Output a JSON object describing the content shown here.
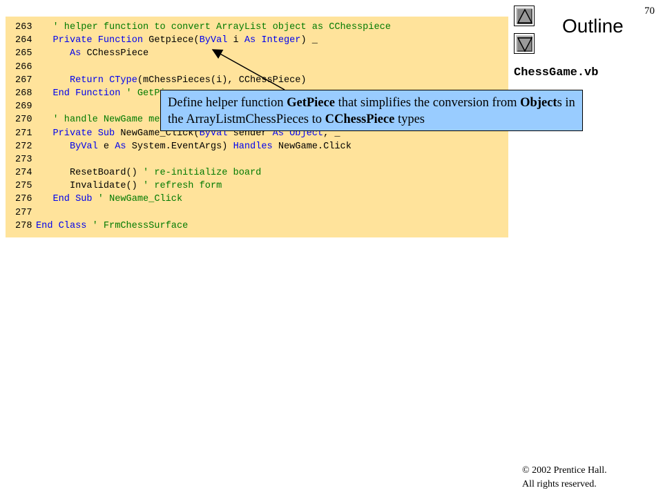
{
  "page_number": "70",
  "outline": {
    "title": "Outline",
    "file_name": "ChessGame.vb",
    "up_icon": "triangle-up-icon",
    "down_icon": "triangle-down-icon"
  },
  "code": {
    "lines": [
      {
        "num": "263",
        "parts": [
          {
            "t": "   ",
            "c": "tx"
          },
          {
            "t": "' helper function to convert ArrayList object as CChesspiece",
            "c": "cm"
          }
        ]
      },
      {
        "num": "264",
        "parts": [
          {
            "t": "   ",
            "c": "tx"
          },
          {
            "t": "Private Function ",
            "c": "kw"
          },
          {
            "t": "Getpiece(",
            "c": "tx"
          },
          {
            "t": "ByVal ",
            "c": "kw"
          },
          {
            "t": "i ",
            "c": "tx"
          },
          {
            "t": "As Integer",
            "c": "kw"
          },
          {
            "t": ") _",
            "c": "tx"
          }
        ]
      },
      {
        "num": "265",
        "parts": [
          {
            "t": "      ",
            "c": "tx"
          },
          {
            "t": "As ",
            "c": "kw"
          },
          {
            "t": "CChessPiece",
            "c": "tx"
          }
        ]
      },
      {
        "num": "266",
        "parts": []
      },
      {
        "num": "267",
        "parts": [
          {
            "t": "      ",
            "c": "tx"
          },
          {
            "t": "Return ",
            "c": "kw"
          },
          {
            "t": "CType",
            "c": "kw"
          },
          {
            "t": "(mChessPieces(i), CChessPiece)",
            "c": "tx"
          }
        ]
      },
      {
        "num": "268",
        "parts": [
          {
            "t": "   ",
            "c": "tx"
          },
          {
            "t": "End Function ",
            "c": "kw"
          },
          {
            "t": "' GetPiece",
            "c": "cm"
          }
        ]
      },
      {
        "num": "269",
        "parts": []
      },
      {
        "num": "270",
        "parts": [
          {
            "t": "   ",
            "c": "tx"
          },
          {
            "t": "' handle NewGame menu option click",
            "c": "cm"
          }
        ]
      },
      {
        "num": "271",
        "parts": [
          {
            "t": "   ",
            "c": "tx"
          },
          {
            "t": "Private Sub ",
            "c": "kw"
          },
          {
            "t": "NewGame_Click(",
            "c": "tx"
          },
          {
            "t": "ByVal ",
            "c": "kw"
          },
          {
            "t": "sender ",
            "c": "tx"
          },
          {
            "t": "As Object",
            "c": "kw"
          },
          {
            "t": ", _",
            "c": "tx"
          }
        ]
      },
      {
        "num": "272",
        "parts": [
          {
            "t": "      ",
            "c": "tx"
          },
          {
            "t": "ByVal ",
            "c": "kw"
          },
          {
            "t": "e ",
            "c": "tx"
          },
          {
            "t": "As ",
            "c": "kw"
          },
          {
            "t": "System.EventArgs) ",
            "c": "tx"
          },
          {
            "t": "Handles ",
            "c": "kw"
          },
          {
            "t": "NewGame.Click",
            "c": "tx"
          }
        ]
      },
      {
        "num": "273",
        "parts": []
      },
      {
        "num": "274",
        "parts": [
          {
            "t": "      ",
            "c": "tx"
          },
          {
            "t": "ResetBoard() ",
            "c": "tx"
          },
          {
            "t": "' re-initialize board",
            "c": "cm"
          }
        ]
      },
      {
        "num": "275",
        "parts": [
          {
            "t": "      ",
            "c": "tx"
          },
          {
            "t": "Invalidate() ",
            "c": "tx"
          },
          {
            "t": "' refresh form",
            "c": "cm"
          }
        ]
      },
      {
        "num": "276",
        "parts": [
          {
            "t": "   ",
            "c": "tx"
          },
          {
            "t": "End Sub ",
            "c": "kw"
          },
          {
            "t": "' NewGame_Click",
            "c": "cm"
          }
        ]
      },
      {
        "num": "277",
        "parts": []
      },
      {
        "num": "278",
        "parts": [
          {
            "t": "End Class ",
            "c": "kw"
          },
          {
            "t": "' FrmChessSurface",
            "c": "cm"
          }
        ]
      }
    ]
  },
  "callout": {
    "parts": [
      {
        "t": "Define helper function ",
        "b": false
      },
      {
        "t": "GetPiece",
        "b": true
      },
      {
        "t": " that simplifies the conversion from ",
        "b": false
      },
      {
        "t": "Object",
        "b": true
      },
      {
        "t": "s in the ArrayListmChessPieces  to ",
        "b": false
      },
      {
        "t": "CChessPiece",
        "b": true
      },
      {
        "t": " types",
        "b": false
      }
    ]
  },
  "copyright": {
    "line1": "© 2002 Prentice Hall.",
    "line2": "All rights reserved."
  },
  "colors": {
    "code_background": "#ffe39b",
    "keyword": "#0000ee",
    "comment": "#007a00",
    "callout_background": "#99ccff"
  }
}
